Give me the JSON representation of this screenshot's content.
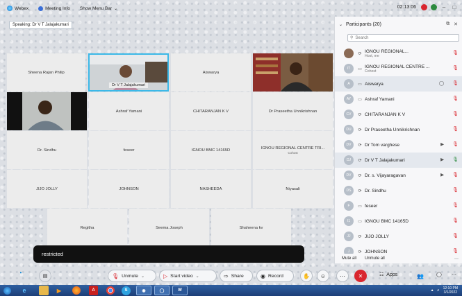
{
  "topbar": {
    "webex_label": "Webex",
    "meeting_info_label": "Meeting Info",
    "show_menu_bar_label": "Show Menu Bar",
    "time": "02:13:06"
  },
  "speaking": "Speaking: Dr V T Jalajakumari",
  "grid": {
    "row1": [
      "Sheena Rajan Philip",
      "Dr V T Jalajakumari",
      "Aiswarya",
      ""
    ],
    "row2": [
      "",
      "Ashraf Yamani",
      "CHITARANJAN K V",
      "Dr Praseetha Unnikrishnan"
    ],
    "row3": [
      "Dr. Sindhu",
      "feseer",
      "IGNOU BMC 14165D",
      "IGNOU REGIONAL CENTRE TRI..."
    ],
    "row3_sub": "Cohost",
    "row4": [
      "JIJO JOLLY",
      "JOHNSON",
      "NASHEEDA",
      "Niyasali"
    ],
    "row5": [
      "Regitha",
      "Seema Joseph",
      "Shaheena kv"
    ]
  },
  "toast": "restricted",
  "controls": {
    "unmute": "Unmute",
    "start_video": "Start video",
    "share": "Share",
    "record": "Record",
    "apps": "Apps"
  },
  "participants": {
    "title": "Participants (20)",
    "search_placeholder": "Search",
    "items": [
      {
        "initials": "",
        "name": "IGNOU REGIONAL...",
        "role": "Host, me"
      },
      {
        "initials": "IT",
        "name": "IGNOU REGIONAL CENTRE ...",
        "role": "Cohost"
      },
      {
        "initials": "A",
        "name": "Aiswarya",
        "role": ""
      },
      {
        "initials": "AY",
        "name": "Ashraf Yamani",
        "role": ""
      },
      {
        "initials": "CV",
        "name": "CHITARANJAN K V",
        "role": ""
      },
      {
        "initials": "DU",
        "name": "Dr Praseetha Unnikrishnan",
        "role": ""
      },
      {
        "initials": "DV",
        "name": "Dr Tom varghese",
        "role": ""
      },
      {
        "initials": "DJ",
        "name": "Dr V T Jalajakumari",
        "role": ""
      },
      {
        "initials": "DV",
        "name": "Dr. s. Vijayaragavan",
        "role": ""
      },
      {
        "initials": "DS",
        "name": "Dr. Sindhu",
        "role": ""
      },
      {
        "initials": "F",
        "name": "feseer",
        "role": ""
      },
      {
        "initials": "I1",
        "name": "IGNOU BMC 14165D",
        "role": ""
      },
      {
        "initials": "JJ",
        "name": "JIJO JOLLY",
        "role": ""
      },
      {
        "initials": "J",
        "name": "JOHNSON",
        "role": ""
      }
    ],
    "mute_all": "Mute all",
    "unmute_all": "Unmute all"
  },
  "taskbar": {
    "time": "12:10 PM",
    "date": "3/1/2022"
  }
}
